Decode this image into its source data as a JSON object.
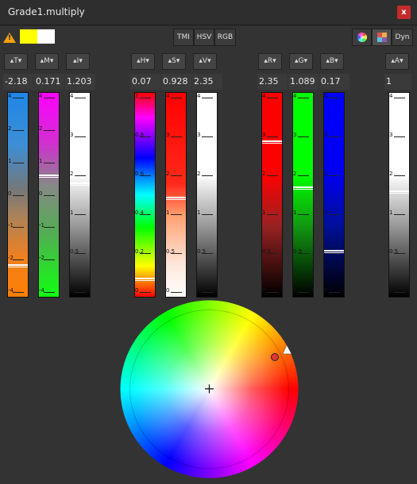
{
  "window": {
    "title": "Grade1.multiply",
    "close_glyph": "x"
  },
  "toolbar": {
    "warning_icon": "warning-icon",
    "swatch_colors": [
      "#ffff00",
      "#ffffff"
    ],
    "mode_buttons": [
      "TMI",
      "HSV",
      "RGB"
    ],
    "right_buttons": {
      "wheel_icon": "color-wheel-icon",
      "palette_icon": "palette-icon",
      "dyn_label": "Dyn"
    }
  },
  "channels": [
    {
      "label": "T",
      "value": "-2.18",
      "ticks": [
        "4",
        "2",
        "1",
        "0",
        "-1",
        "-2",
        "-4"
      ],
      "handle_level": 0.86
    },
    {
      "label": "M",
      "value": "0.171",
      "ticks": [
        "4",
        "2",
        "1",
        "0",
        "-1",
        "-2",
        "-4"
      ],
      "handle_level": 0.41
    },
    {
      "label": "I",
      "value": "1.203",
      "ticks": [
        "4",
        "3",
        "2",
        "1",
        "0.5",
        "0"
      ],
      "handle_level": 0.45
    },
    {
      "label": "H",
      "value": "0.07",
      "ticks": [
        "1",
        "0.8",
        "0.6",
        "0.4",
        "0.2",
        "0"
      ],
      "handle_level": 0.93
    },
    {
      "label": "S",
      "value": "0.928",
      "ticks": [
        "4",
        "3",
        "2",
        "1",
        "0.5",
        "0"
      ],
      "handle_level": 0.52
    },
    {
      "label": "V",
      "value": "2.35",
      "ticks": [
        "4",
        "3",
        "2",
        "1",
        "0.5",
        "0"
      ],
      "handle_level": 0.24
    },
    {
      "label": "R",
      "value": "2.35",
      "ticks": [
        "4",
        "3",
        "2",
        "1",
        "0.5",
        "0"
      ],
      "handle_level": 0.24
    },
    {
      "label": "G",
      "value": "1.089",
      "ticks": [
        "4",
        "3",
        "2",
        "1",
        "0.5",
        "0"
      ],
      "handle_level": 0.47
    },
    {
      "label": "B",
      "value": "0.17",
      "ticks": [
        "4",
        "3",
        "2",
        "1",
        "0.5",
        "0"
      ],
      "handle_level": 0.79
    },
    {
      "label": "A",
      "value": "1",
      "ticks": [
        "4",
        "3",
        "2",
        "1",
        "0.5",
        "0"
      ],
      "handle_level": 0.49
    }
  ],
  "colors": {
    "accent_warning": "#f2a20c",
    "close_bg": "#c42b2b",
    "marker": "#e03535"
  }
}
